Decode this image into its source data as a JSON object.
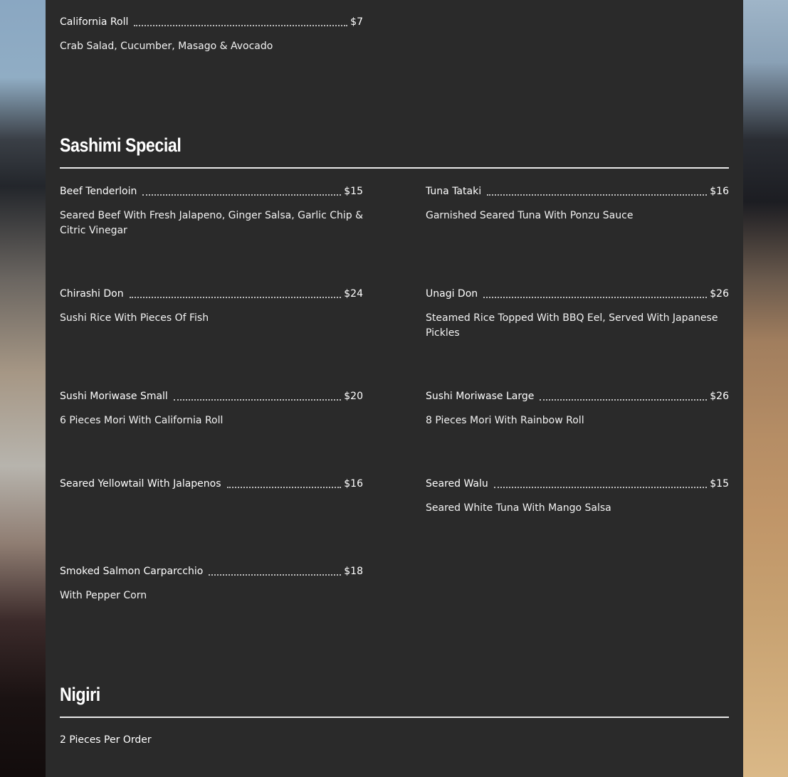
{
  "top_item": {
    "name": "California Roll",
    "price": "$7",
    "description": "Crab Salad, Cucumber, Masago & Avocado"
  },
  "sashimi": {
    "title": "Sashimi Special",
    "items": [
      {
        "name": "Beef Tenderloin",
        "price": "$15",
        "description": "Seared Beef With Fresh Jalapeno, Ginger Salsa, Garlic Chip & Citric Vinegar"
      },
      {
        "name": "Tuna Tataki",
        "price": "$16",
        "description": "Garnished Seared Tuna With Ponzu Sauce"
      },
      {
        "name": "Chirashi Don",
        "price": "$24",
        "description": "Sushi Rice With Pieces Of Fish"
      },
      {
        "name": "Unagi Don",
        "price": "$26",
        "description": "Steamed Rice Topped With BBQ Eel, Served With Japanese Pickles"
      },
      {
        "name": "Sushi Moriwase Small",
        "price": "$20",
        "description": "6 Pieces Mori With California Roll"
      },
      {
        "name": "Sushi Moriwase Large",
        "price": "$26",
        "description": "8 Pieces Mori With Rainbow Roll"
      },
      {
        "name": "Seared Yellowtail With Jalapenos",
        "price": "$16",
        "description": ""
      },
      {
        "name": "Seared Walu",
        "price": "$15",
        "description": "Seared White Tuna With Mango Salsa"
      },
      {
        "name": "Smoked Salmon Carparcchio",
        "price": "$18",
        "description": "With Pepper Corn"
      }
    ]
  },
  "nigiri": {
    "title": "Nigiri",
    "note": "2 Pieces Per Order"
  }
}
